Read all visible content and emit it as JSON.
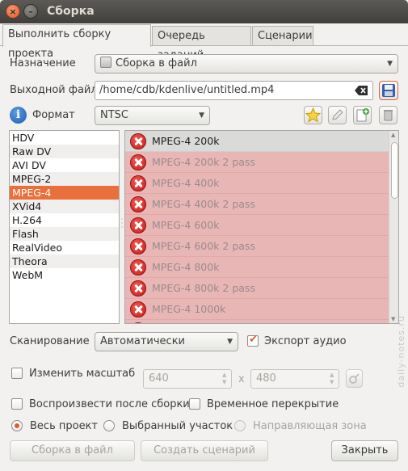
{
  "window": {
    "title": "Сборка",
    "close_glyph": "×",
    "minimize_glyph": "–"
  },
  "tabs": [
    {
      "label": "Выполнить сборку проекта",
      "active": true
    },
    {
      "label": "Очередь заданий",
      "active": false
    },
    {
      "label": "Сценарии",
      "active": false
    }
  ],
  "destination": {
    "label": "Назначение",
    "value": "Сборка в файл"
  },
  "output_file": {
    "label": "Выходной файл",
    "value": "/home/cdb/kdenlive/untitled.mp4"
  },
  "format": {
    "label": "Формат",
    "standard": "NTSC"
  },
  "formats": [
    "HDV",
    "Raw DV",
    "AVI DV",
    "MPEG-2",
    "MPEG-4",
    "XVid4",
    "H.264",
    "Flash",
    "RealVideo",
    "Theora",
    "WebM"
  ],
  "selected_format_index": 4,
  "profiles": [
    {
      "label": "MPEG-4 200k",
      "selected": true
    },
    {
      "label": "MPEG-4 200k 2 pass",
      "selected": false
    },
    {
      "label": "MPEG-4 400k",
      "selected": false
    },
    {
      "label": "MPEG-4 400k 2 pass",
      "selected": false
    },
    {
      "label": "MPEG-4 600k",
      "selected": false
    },
    {
      "label": "MPEG-4 600k 2 pass",
      "selected": false
    },
    {
      "label": "MPEG-4 800k",
      "selected": false
    },
    {
      "label": "MPEG-4 800k 2 pass",
      "selected": false
    },
    {
      "label": "MPEG-4 1000k",
      "selected": false
    }
  ],
  "scan": {
    "label": "Сканирование",
    "value": "Автоматически"
  },
  "export_audio": {
    "label": "Экспорт аудио",
    "checked": true
  },
  "rescale": {
    "label": "Изменить масштаб",
    "checked": false,
    "width": "640",
    "height": "480",
    "separator": "x"
  },
  "play_after": {
    "label": "Воспроизвести после сборки",
    "checked": false
  },
  "overlay": {
    "label": "Временное перекрытие",
    "checked": false
  },
  "range": {
    "whole": {
      "label": "Весь проект",
      "selected": true
    },
    "selection": {
      "label": "Выбранный участок",
      "selected": false
    },
    "guides": {
      "label": "Направляющая зона",
      "selected": false,
      "disabled": true
    }
  },
  "buttons": {
    "render": "Сборка в файл",
    "script": "Создать сценарий",
    "close": "Закрыть"
  },
  "watermark": "daily-notes.ru",
  "colors": {
    "accent": "#e9703b",
    "error_row": "#e9b6b6",
    "titlebar": "#403f3b"
  },
  "icons": [
    "info-icon",
    "star-icon",
    "edit-icon",
    "new-profile-icon",
    "delete-icon",
    "save-icon",
    "clear-icon",
    "x-error-icon",
    "lock-ratio-icon"
  ]
}
